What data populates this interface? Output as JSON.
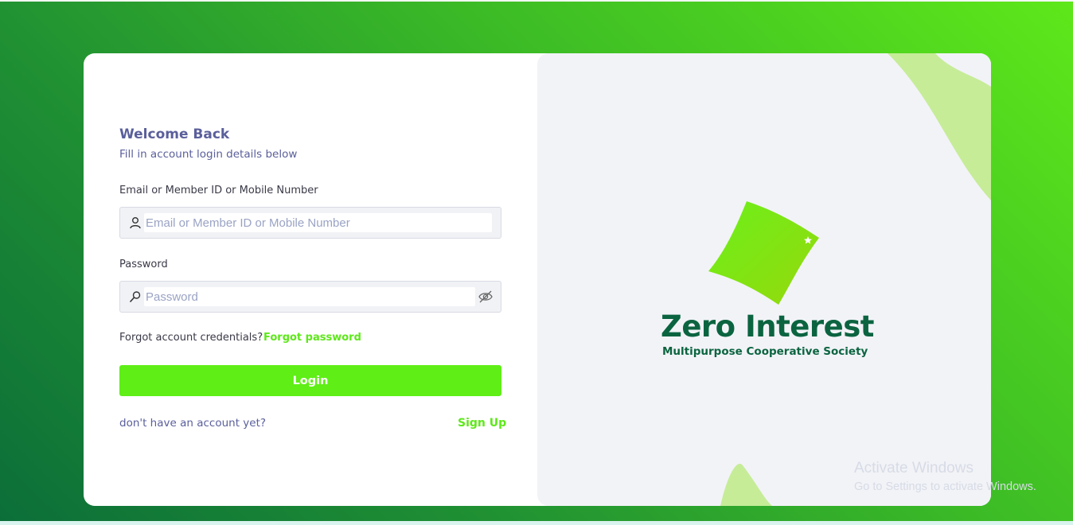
{
  "login": {
    "title": "Welcome Back",
    "subtitle": "Fill in account login details below",
    "email_label": "Email or Member ID or Mobile Number",
    "email_placeholder": "Email or Member ID or Mobile Number",
    "password_label": "Password",
    "password_placeholder": "Password",
    "forgot_text": "Forgot account credentials?",
    "forgot_link": "Forgot password",
    "login_button": "Login",
    "no_account_text": "don't have an account yet?",
    "signup_link": "Sign Up"
  },
  "brand": {
    "name": "Zero Interest",
    "tagline": "Multipurpose Cooperative Society"
  },
  "watermark": {
    "line1": "Activate Windows",
    "line2": "Go to Settings to activate Windows."
  },
  "icons": {
    "email_field": "user-icon",
    "password_field": "key-icon",
    "password_toggle": "eye-slash-icon"
  },
  "colors": {
    "accent": "#5fee16",
    "brand_dark": "#0b6440",
    "text_primary": "#5a5f9b"
  }
}
